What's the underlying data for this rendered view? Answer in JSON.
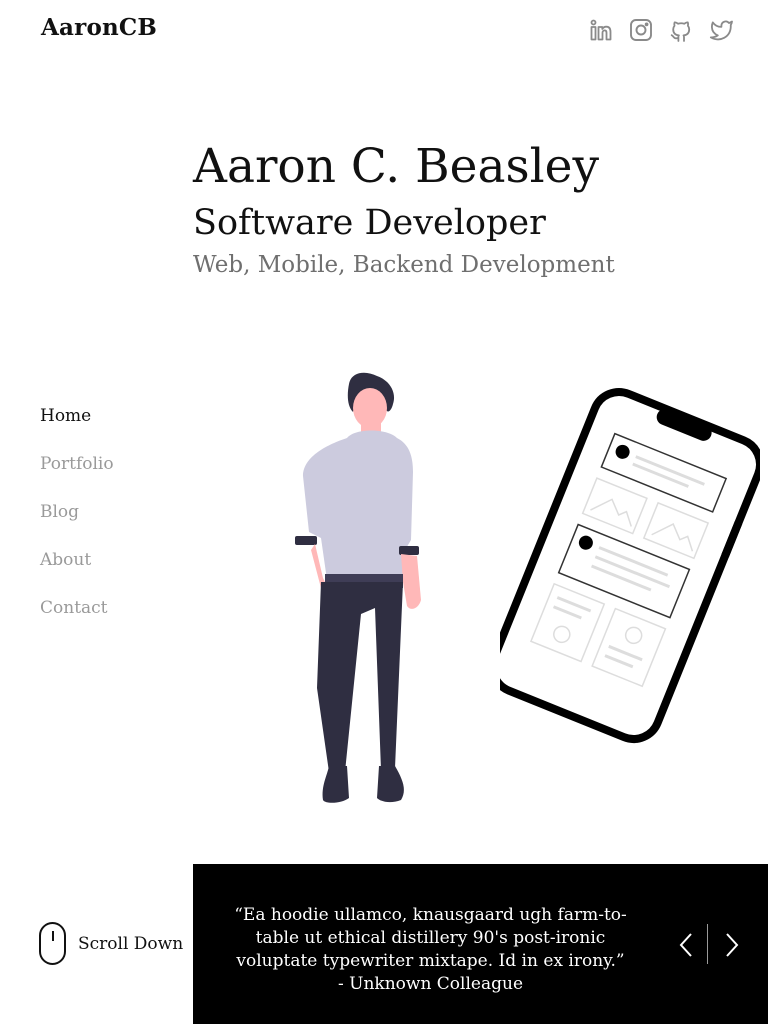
{
  "brand": "AaronCB",
  "socials": [
    {
      "icon": "linkedin-icon"
    },
    {
      "icon": "instagram-icon"
    },
    {
      "icon": "github-icon"
    },
    {
      "icon": "twitter-icon"
    }
  ],
  "hero": {
    "name": "Aaron C. Beasley",
    "title": "Software Developer",
    "subtitle": "Web, Mobile, Backend Development"
  },
  "nav": {
    "items": [
      {
        "label": "Home",
        "active": true
      },
      {
        "label": "Portfolio",
        "active": false
      },
      {
        "label": "Blog",
        "active": false
      },
      {
        "label": "About",
        "active": false
      },
      {
        "label": "Contact",
        "active": false
      }
    ]
  },
  "scroll": {
    "label": "Scroll Down"
  },
  "quote": {
    "text": "“Ea hoodie ullamco, knausgaard ugh farm-to-table ut ethical distillery 90's post-ironic voluptate typewriter mixtape. Id in ex irony.”",
    "author": "- Unknown Colleague"
  },
  "colors": {
    "text": "#111111",
    "muted": "#9a9a9a",
    "subtitle": "#6f6f6f",
    "panel": "#000000",
    "shirt": "#cccbde",
    "pants": "#2f2e41",
    "skin": "#ffb8b8"
  }
}
